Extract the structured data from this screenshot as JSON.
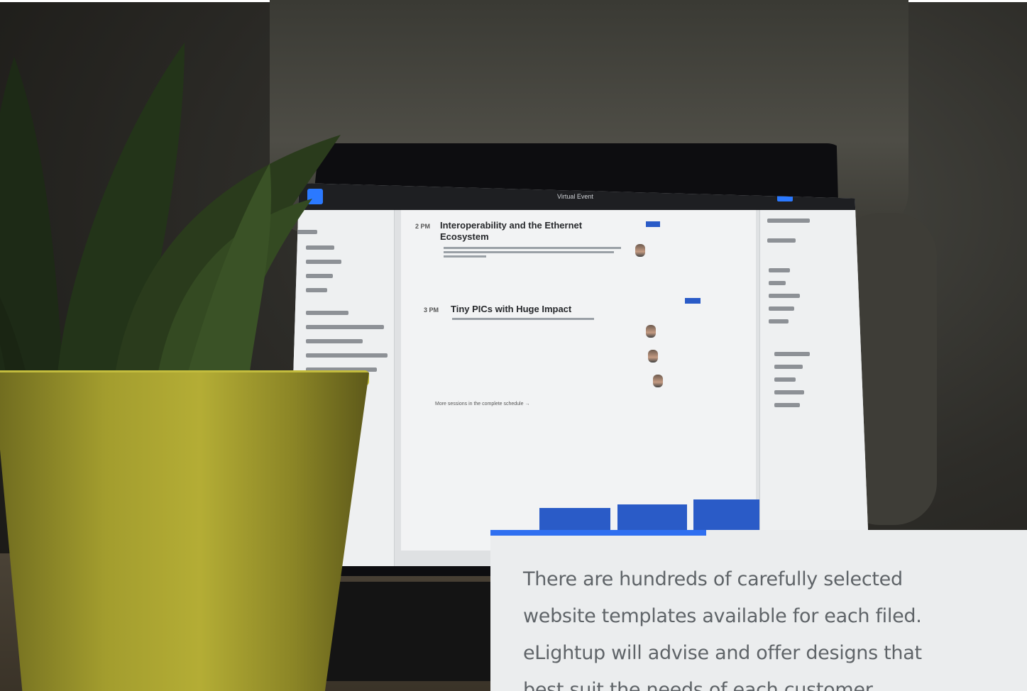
{
  "screen": {
    "app_title": "Virtual Event",
    "headline_1": "Interoperability and the Ethernet Ecosystem",
    "headline_2": "Tiny PICs with Huge Impact",
    "time_1": "2 PM",
    "time_2": "3 PM",
    "more_link": "More sessions in the complete schedule →"
  },
  "info_card": {
    "text": "There are hundreds of carefully selected website templates available for each filed. eLightup will advise and offer designs that best suit the needs of each customer."
  },
  "colors": {
    "accent": "#2f6ff0",
    "card_background": "#ebedee",
    "text": "#5f6468"
  }
}
